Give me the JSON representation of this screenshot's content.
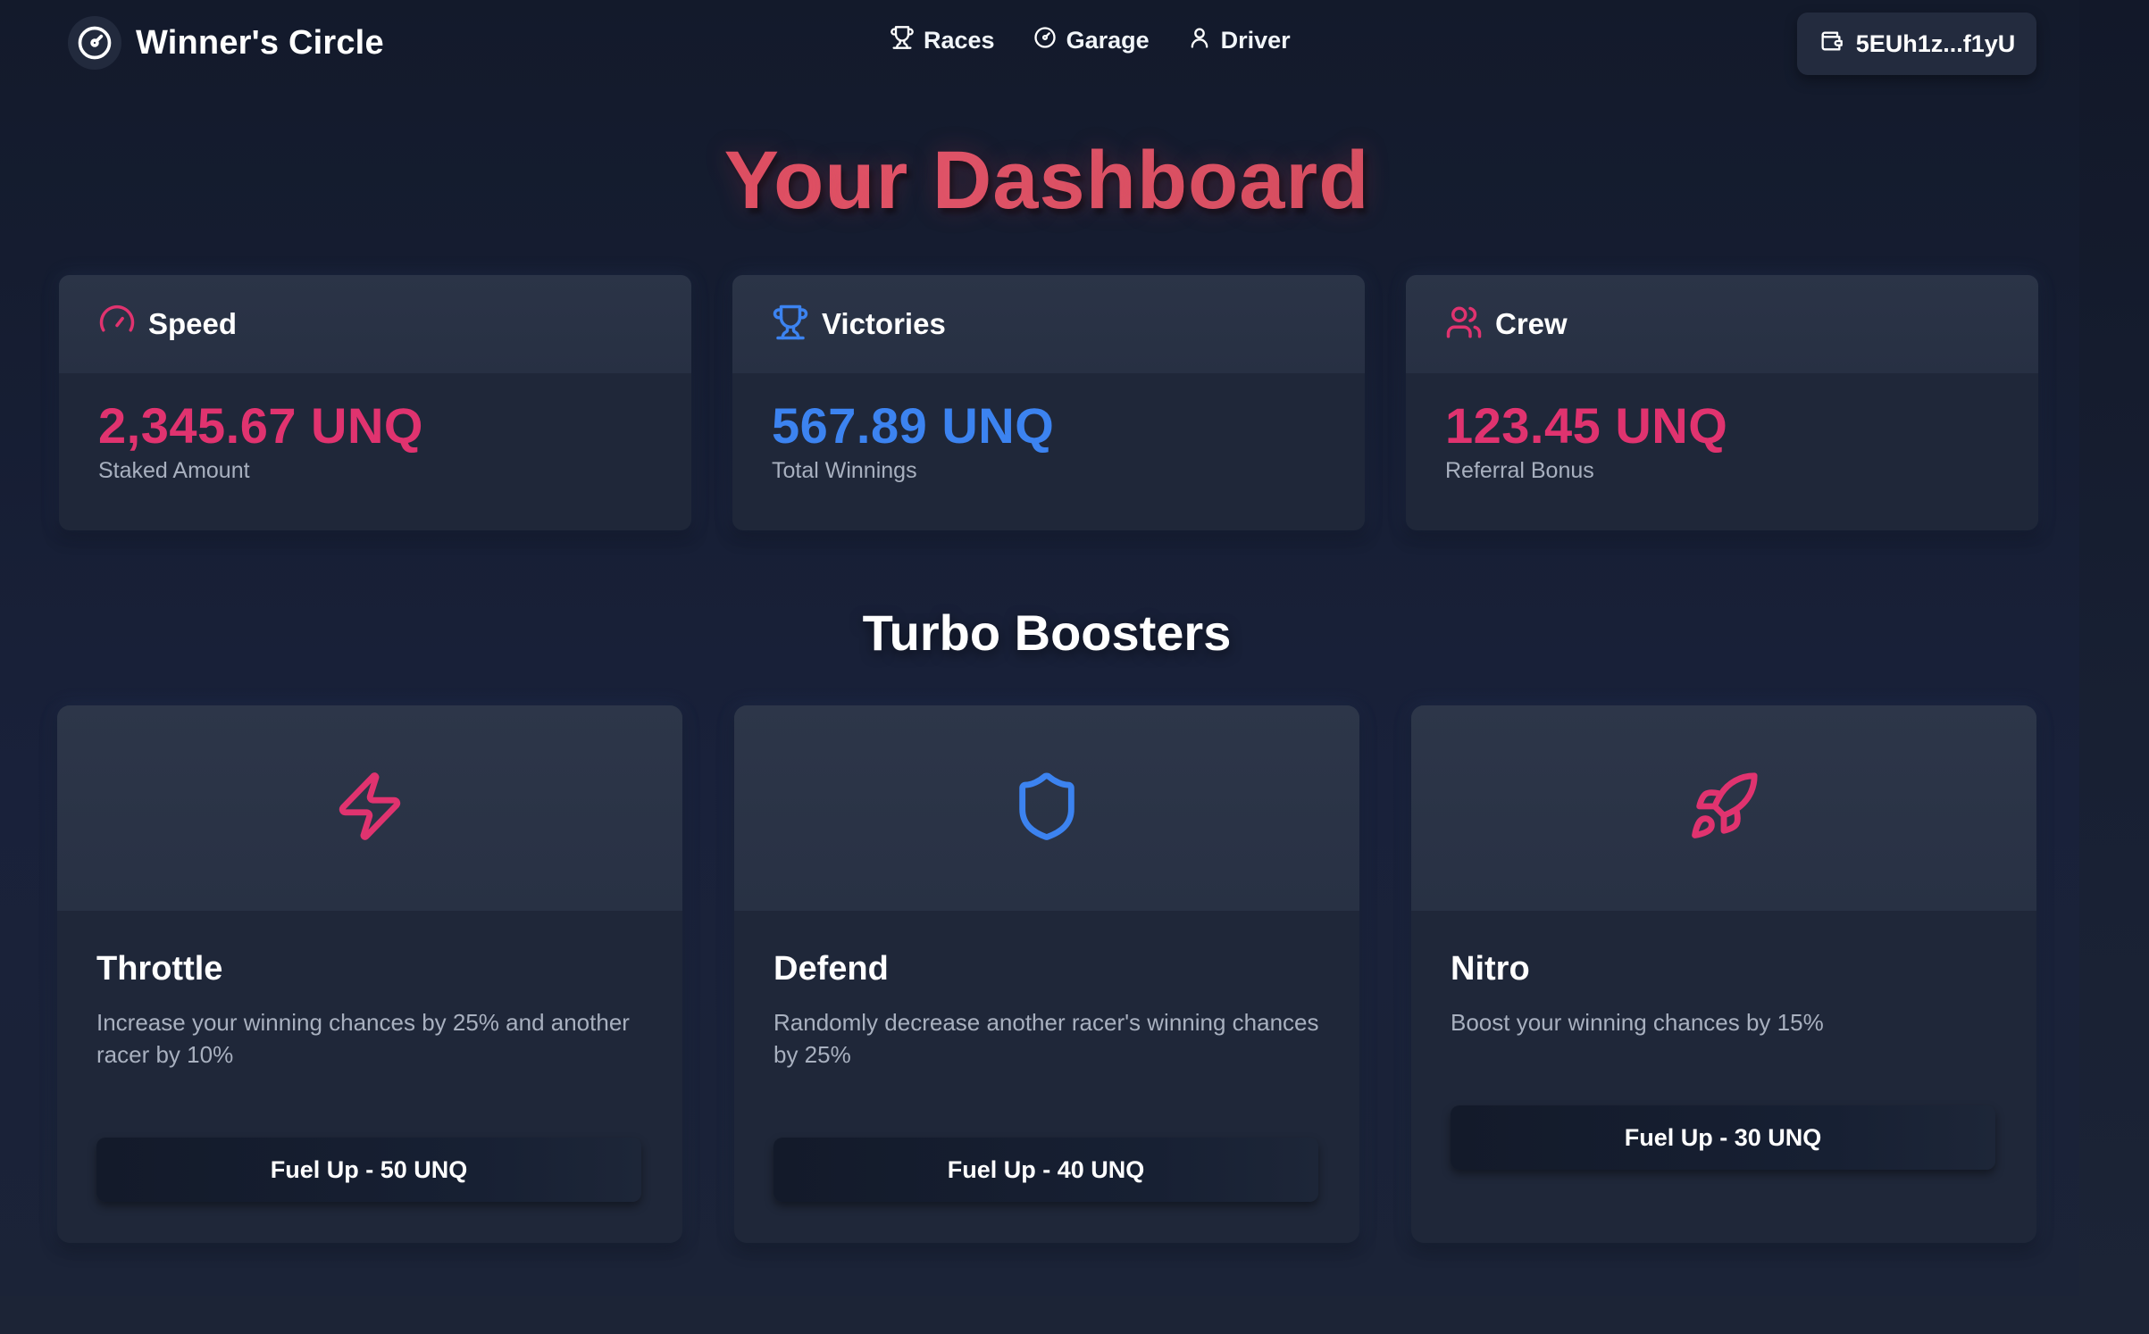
{
  "app": {
    "brand": "Winner's Circle"
  },
  "nav": {
    "links": [
      {
        "label": "Races",
        "icon": "trophy-icon"
      },
      {
        "label": "Garage",
        "icon": "gauge-icon"
      },
      {
        "label": "Driver",
        "icon": "user-icon"
      }
    ],
    "wallet": {
      "label": "5EUh1z...f1yU",
      "icon": "wallet-icon"
    }
  },
  "dashboard": {
    "title": "Your Dashboard",
    "stats": [
      {
        "label": "Speed",
        "value": "2,345.67 UNQ",
        "sub": "Staked Amount",
        "icon": "speedometer-icon",
        "color": "#e0336f"
      },
      {
        "label": "Victories",
        "value": "567.89 UNQ",
        "sub": "Total Winnings",
        "icon": "trophy-icon",
        "color": "#3c83f0"
      },
      {
        "label": "Crew",
        "value": "123.45 UNQ",
        "sub": "Referral Bonus",
        "icon": "users-icon",
        "color": "#e0336f"
      }
    ]
  },
  "boosters": {
    "title": "Turbo Boosters",
    "items": [
      {
        "name": "Throttle",
        "description": "Increase your winning chances by 25% and another racer by 10%",
        "button": "Fuel Up - 50 UNQ",
        "icon": "lightning-icon",
        "color": "#e0336f"
      },
      {
        "name": "Defend",
        "description": "Randomly decrease another racer's winning chances by 25%",
        "button": "Fuel Up - 40 UNQ",
        "icon": "shield-icon",
        "color": "#3c83f0"
      },
      {
        "name": "Nitro",
        "description": "Boost your winning chances by 15%",
        "button": "Fuel Up - 30 UNQ",
        "icon": "rocket-icon",
        "color": "#e0336f"
      }
    ]
  },
  "colors": {
    "background": "#161d2e",
    "card": "#1f2739",
    "accent_pink": "#e0336f",
    "accent_blue": "#3c83f0",
    "title_gradient": "#d94152"
  }
}
